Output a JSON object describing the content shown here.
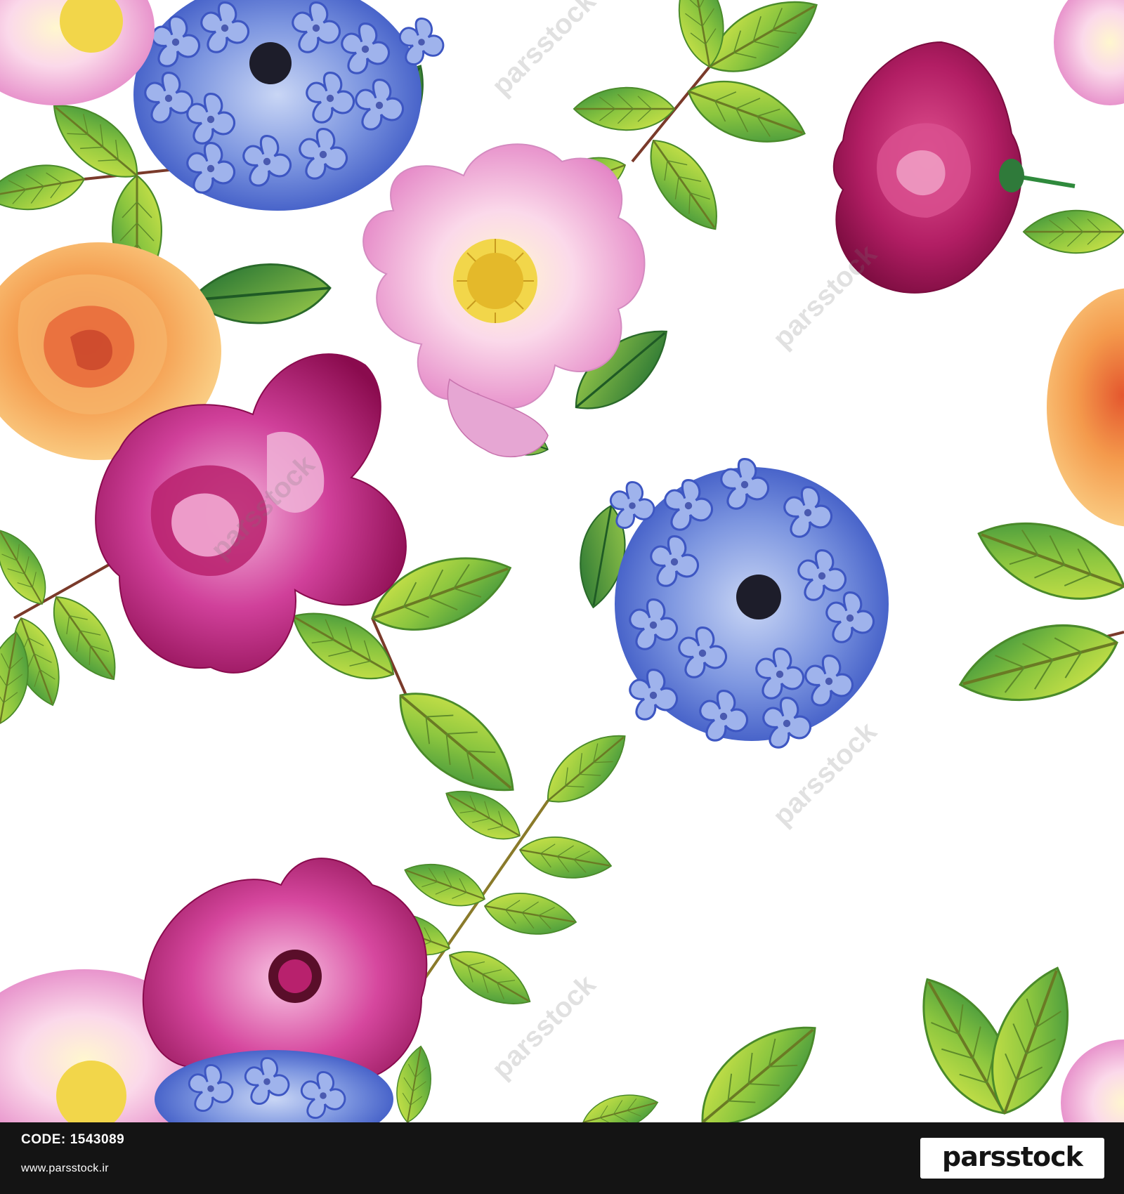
{
  "artwork": {
    "subject": "seamless watercolor floral pattern",
    "background_color": "#ffffff",
    "elements": [
      "blue-phlox-cluster-top",
      "blue-phlox-cluster-center",
      "pink-wild-rose-top",
      "magenta-rose-left",
      "orange-rose-left",
      "crimson-rose-top-right",
      "pink-peony-bottom",
      "rose-leaf-branches"
    ]
  },
  "watermark": {
    "text": "parsstock"
  },
  "footer": {
    "code_label": "CODE:",
    "code_value": "1543089",
    "url": "www.parsstock.ir",
    "brand": "parsstock",
    "background_color": "#141414"
  }
}
